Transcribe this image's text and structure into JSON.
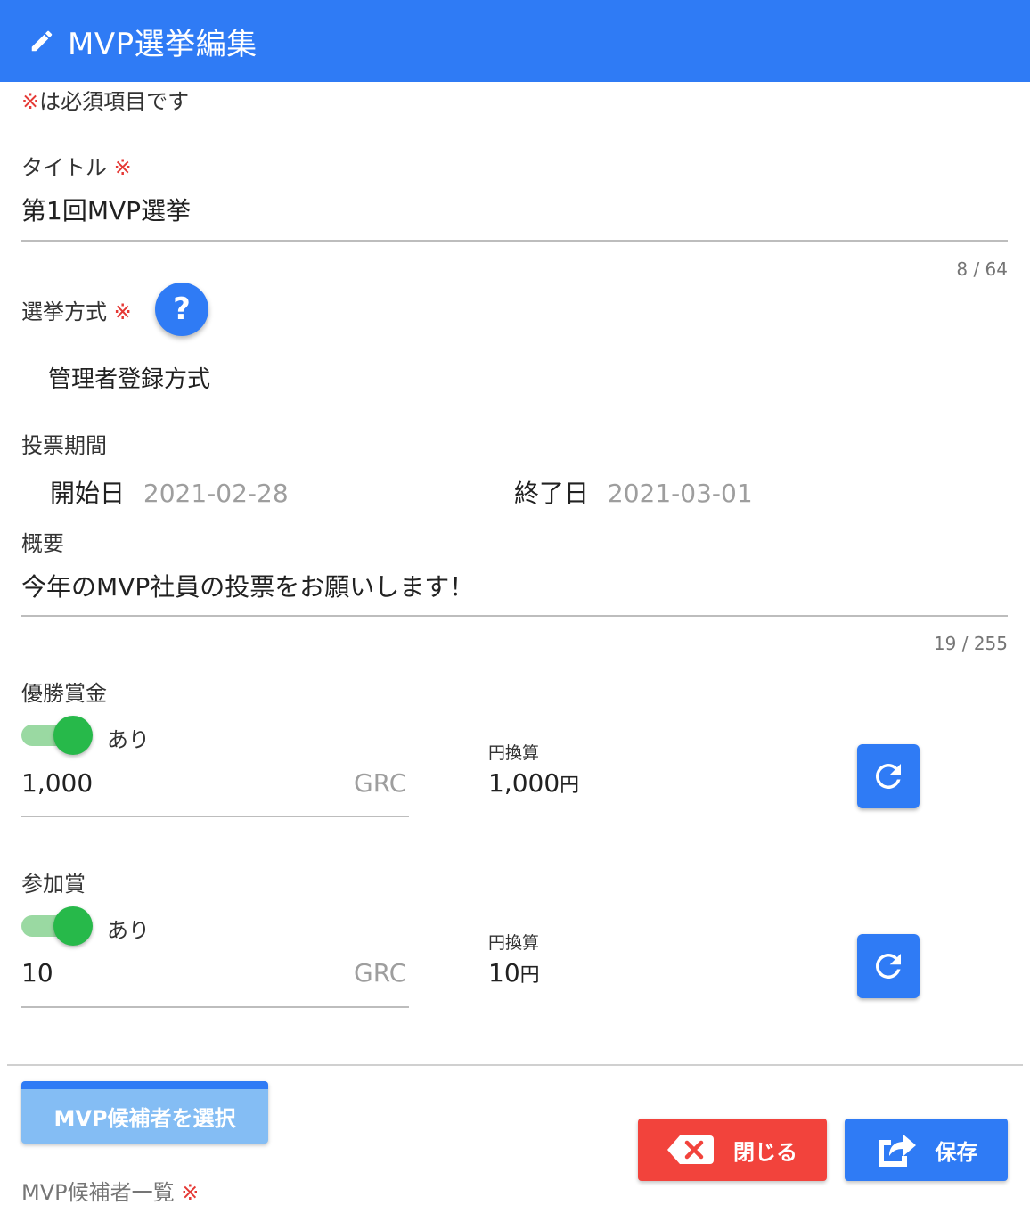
{
  "header": {
    "title": "MVP選挙編集",
    "icon": "pencil-icon"
  },
  "required_note": {
    "mark": "※",
    "text": "は必須項目です"
  },
  "required_mark": "※",
  "title_field": {
    "label": "タイトル",
    "value": "第1回MVP選挙",
    "counter": "8 / 64"
  },
  "election_method": {
    "label": "選挙方式",
    "help_label": "?",
    "value": "管理者登録方式"
  },
  "voting_period": {
    "label": "投票期間",
    "start_label": "開始日",
    "start_value": "2021-02-28",
    "end_label": "終了日",
    "end_value": "2021-03-01"
  },
  "summary_field": {
    "label": "概要",
    "value": "今年のMVP社員の投票をお願いします！",
    "counter": "19 / 255"
  },
  "winner_prize": {
    "label": "優勝賞金",
    "toggle_label": "あり",
    "toggle_on": true,
    "amount": "1,000",
    "unit": "GRC",
    "yen_label": "円換算",
    "yen_value": "1,000",
    "yen_unit": "円"
  },
  "participation_prize": {
    "label": "参加賞",
    "toggle_label": "あり",
    "toggle_on": true,
    "amount": "10",
    "unit": "GRC",
    "yen_label": "円換算",
    "yen_value": "10",
    "yen_unit": "円"
  },
  "candidates": {
    "select_button": "MVP候補者を選択",
    "list_label": "MVP候補者一覧"
  },
  "actions": {
    "close_label": "閉じる",
    "save_label": "保存"
  },
  "colors": {
    "primary": "#2f7bf5",
    "danger": "#f2433c",
    "toggle_on": "#27b94a",
    "required": "#e53935"
  }
}
